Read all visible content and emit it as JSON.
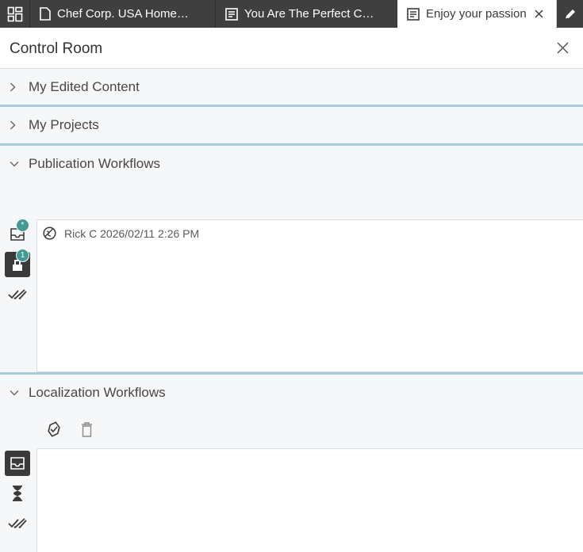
{
  "tabs": [
    {
      "label": "Chef Corp. USA Home…",
      "icon": "document-icon"
    },
    {
      "label": "You Are The Perfect C…",
      "icon": "article-icon"
    },
    {
      "label": "Enjoy your passion",
      "icon": "article-icon",
      "active": true
    },
    {
      "label": "",
      "icon": "pencil-icon"
    }
  ],
  "header": {
    "title": "Control Room"
  },
  "sections": {
    "edited": {
      "label": "My Edited Content"
    },
    "projects": {
      "label": "My Projects"
    },
    "publication": {
      "label": "Publication Workflows"
    },
    "localization": {
      "label": "Localization Workflows"
    }
  },
  "publication_rail": {
    "inbox_badge": "*",
    "assigned_badge": "1"
  },
  "publication_list": [
    {
      "user": "Rick C",
      "date": "2026/02/11 2:26 PM"
    }
  ],
  "colors": {
    "accent": "#a8cbd9",
    "badge": "#3f9b93",
    "tabbar": "#3f3f3f"
  }
}
